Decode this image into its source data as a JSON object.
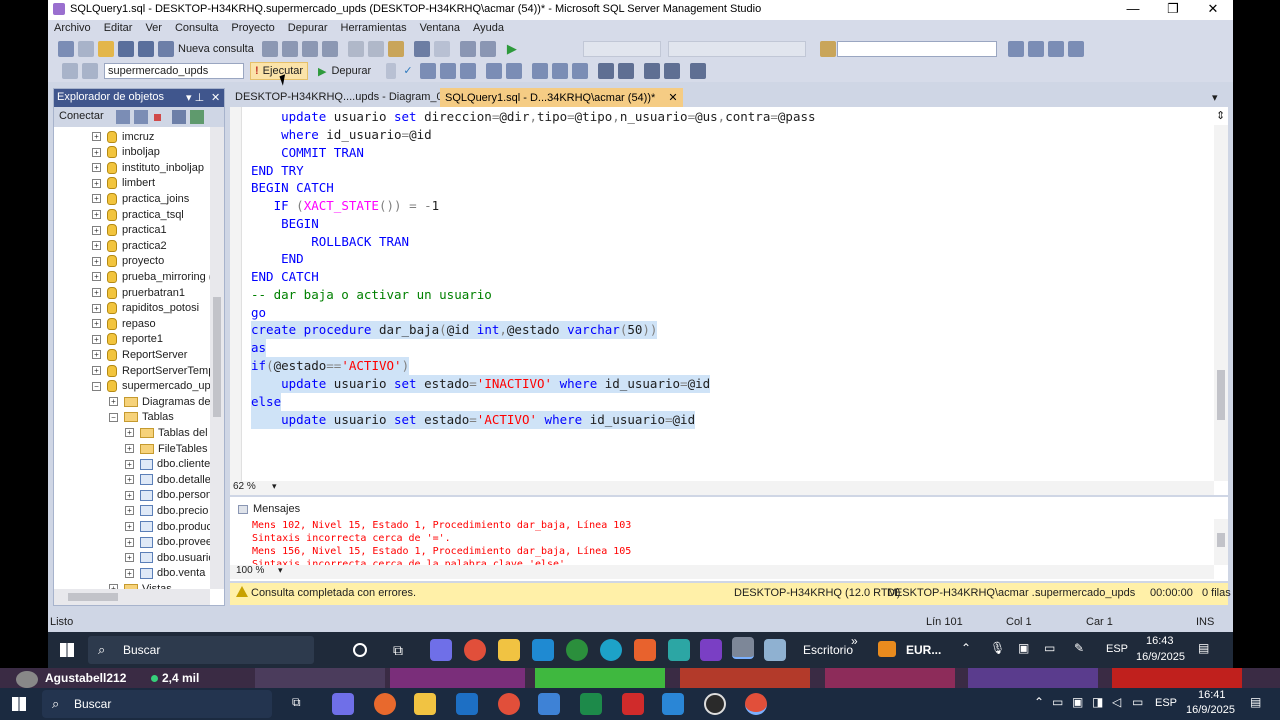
{
  "window": {
    "title": "SQLQuery1.sql - DESKTOP-H34KRHQ.supermercado_upds (DESKTOP-H34KRHQ\\acmar (54))* - Microsoft SQL Server Management Studio"
  },
  "menu": [
    "Archivo",
    "Editar",
    "Ver",
    "Consulta",
    "Proyecto",
    "Depurar",
    "Herramientas",
    "Ventana",
    "Ayuda"
  ],
  "toolbar": {
    "new_query": "Nueva consulta",
    "database": "supermercado_upds",
    "execute": "Ejecutar",
    "debug": "Depurar"
  },
  "explorer": {
    "title": "Explorador de objetos",
    "connect": "Conectar",
    "items": [
      {
        "label": "imcruz",
        "type": "db",
        "exp": "+"
      },
      {
        "label": "inboljap",
        "type": "db",
        "exp": "+"
      },
      {
        "label": "instituto_inboljap",
        "type": "db",
        "exp": "+"
      },
      {
        "label": "limbert",
        "type": "db",
        "exp": "+"
      },
      {
        "label": "practica_joins",
        "type": "db",
        "exp": "+"
      },
      {
        "label": "practica_tsql",
        "type": "db",
        "exp": "+"
      },
      {
        "label": "practica1",
        "type": "db",
        "exp": "+"
      },
      {
        "label": "practica2",
        "type": "db",
        "exp": "+"
      },
      {
        "label": "proyecto",
        "type": "db",
        "exp": "+"
      },
      {
        "label": "prueba_mirroring (",
        "type": "db",
        "exp": "+"
      },
      {
        "label": "pruerbatran1",
        "type": "db",
        "exp": "+"
      },
      {
        "label": "rapiditos_potosi",
        "type": "db",
        "exp": "+"
      },
      {
        "label": "repaso",
        "type": "db",
        "exp": "+"
      },
      {
        "label": "reporte1",
        "type": "db",
        "exp": "+"
      },
      {
        "label": "ReportServer",
        "type": "db",
        "exp": "+"
      },
      {
        "label": "ReportServerTemp",
        "type": "db",
        "exp": "+"
      },
      {
        "label": "supermercado_upc",
        "type": "db",
        "exp": "−"
      },
      {
        "label": "Diagramas de b",
        "type": "folder",
        "exp": "+"
      },
      {
        "label": "Tablas",
        "type": "folder",
        "exp": "−"
      },
      {
        "label": "Tablas del s",
        "type": "folder",
        "exp": "+"
      },
      {
        "label": "FileTables",
        "type": "folder",
        "exp": "+"
      },
      {
        "label": "dbo.cliente",
        "type": "table",
        "exp": "+"
      },
      {
        "label": "dbo.detalle",
        "type": "table",
        "exp": "+"
      },
      {
        "label": "dbo.person",
        "type": "table",
        "exp": "+"
      },
      {
        "label": "dbo.precio",
        "type": "table",
        "exp": "+"
      },
      {
        "label": "dbo.produc",
        "type": "table",
        "exp": "+"
      },
      {
        "label": "dbo.provee",
        "type": "table",
        "exp": "+"
      },
      {
        "label": "dbo.usuario",
        "type": "table",
        "exp": "+"
      },
      {
        "label": "dbo.venta",
        "type": "table",
        "exp": "+"
      },
      {
        "label": "Vistas",
        "type": "folder",
        "exp": "+"
      }
    ]
  },
  "tabs": [
    {
      "label": "DESKTOP-H34KRHQ....upds - Diagram_0*"
    },
    {
      "label": "SQLQuery1.sql - D...34KRHQ\\acmar (54))*"
    }
  ],
  "editor": {
    "zoom": "62 %"
  },
  "messages": {
    "tab": "Mensajes",
    "zoom": "100 %",
    "lines": [
      "Mens 102, Nivel 15, Estado 1, Procedimiento dar_baja, Línea 103",
      "Sintaxis incorrecta cerca de '='.",
      "Mens 156, Nivel 15, Estado 1, Procedimiento dar_baja, Línea 105",
      "Sintaxis incorrecta cerca de la palabra clave 'else'."
    ]
  },
  "query_status": {
    "text": "Consulta completada con errores.",
    "server": "DESKTOP-H34KRHQ (12.0 RTM)",
    "user": "DESKTOP-H34KRHQ\\acmar ...",
    "database": "supermercado_upds",
    "time": "00:00:00",
    "rows": "0 filas"
  },
  "statusbar": {
    "ready": "Listo",
    "line": "Lín 101",
    "col": "Col 1",
    "car": "Car 1",
    "ins": "INS"
  },
  "taskbar_inner": {
    "search": "Buscar",
    "desktop": "Escritorio",
    "weather": "EUR...",
    "lang": "ESP",
    "time": "16:43",
    "date": "16/9/2025"
  },
  "stream": {
    "user": "Agustabell212",
    "viewers": "2,4 mil"
  },
  "taskbar_outer": {
    "search": "Buscar",
    "lang": "ESP",
    "time": "16:41",
    "date": "16/9/2025"
  },
  "colors": {
    "accent": "#f5cc84",
    "selection": "#cfe3f7",
    "error": "#ff0000",
    "status_warning": "#fff0a8"
  }
}
